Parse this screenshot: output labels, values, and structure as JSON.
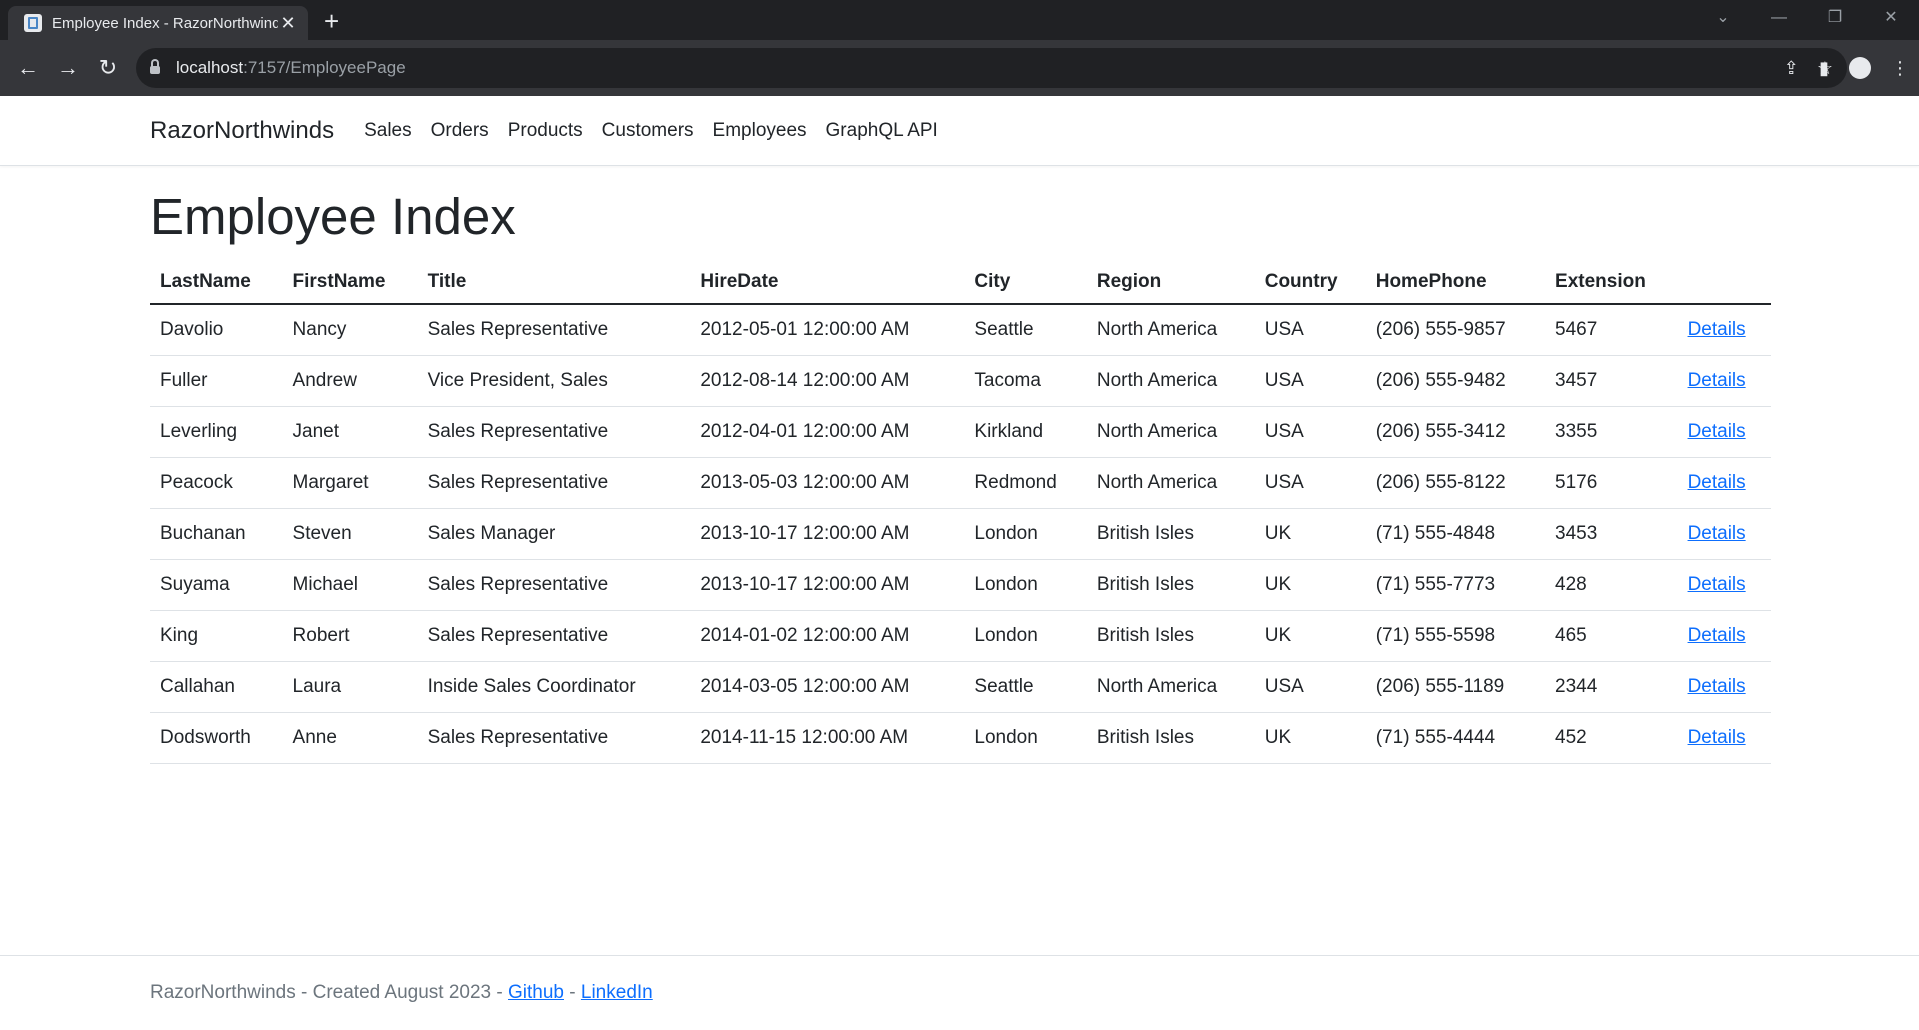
{
  "browser": {
    "tab_title": "Employee Index - RazorNorthwinds",
    "url_host": "localhost",
    "url_path": ":7157/EmployeePage"
  },
  "nav": {
    "brand": "RazorNorthwinds",
    "links": [
      "Sales",
      "Orders",
      "Products",
      "Customers",
      "Employees",
      "GraphQL API"
    ]
  },
  "page": {
    "title": "Employee Index"
  },
  "table": {
    "headers": [
      "LastName",
      "FirstName",
      "Title",
      "HireDate",
      "City",
      "Region",
      "Country",
      "HomePhone",
      "Extension"
    ],
    "details_label": "Details",
    "rows": [
      [
        "Davolio",
        "Nancy",
        "Sales Representative",
        "2012-05-01 12:00:00 AM",
        "Seattle",
        "North America",
        "USA",
        "(206) 555-9857",
        "5467"
      ],
      [
        "Fuller",
        "Andrew",
        "Vice President, Sales",
        "2012-08-14 12:00:00 AM",
        "Tacoma",
        "North America",
        "USA",
        "(206) 555-9482",
        "3457"
      ],
      [
        "Leverling",
        "Janet",
        "Sales Representative",
        "2012-04-01 12:00:00 AM",
        "Kirkland",
        "North America",
        "USA",
        "(206) 555-3412",
        "3355"
      ],
      [
        "Peacock",
        "Margaret",
        "Sales Representative",
        "2013-05-03 12:00:00 AM",
        "Redmond",
        "North America",
        "USA",
        "(206) 555-8122",
        "5176"
      ],
      [
        "Buchanan",
        "Steven",
        "Sales Manager",
        "2013-10-17 12:00:00 AM",
        "London",
        "British Isles",
        "UK",
        "(71) 555-4848",
        "3453"
      ],
      [
        "Suyama",
        "Michael",
        "Sales Representative",
        "2013-10-17 12:00:00 AM",
        "London",
        "British Isles",
        "UK",
        "(71) 555-7773",
        "428"
      ],
      [
        "King",
        "Robert",
        "Sales Representative",
        "2014-01-02 12:00:00 AM",
        "London",
        "British Isles",
        "UK",
        "(71) 555-5598",
        "465"
      ],
      [
        "Callahan",
        "Laura",
        "Inside Sales Coordinator",
        "2014-03-05 12:00:00 AM",
        "Seattle",
        "North America",
        "USA",
        "(206) 555-1189",
        "2344"
      ],
      [
        "Dodsworth",
        "Anne",
        "Sales Representative",
        "2014-11-15 12:00:00 AM",
        "London",
        "British Isles",
        "UK",
        "(71) 555-4444",
        "452"
      ]
    ]
  },
  "footer": {
    "text": "RazorNorthwinds - Created August 2023 -",
    "separator": "-",
    "github": "Github",
    "linkedin": "LinkedIn"
  }
}
